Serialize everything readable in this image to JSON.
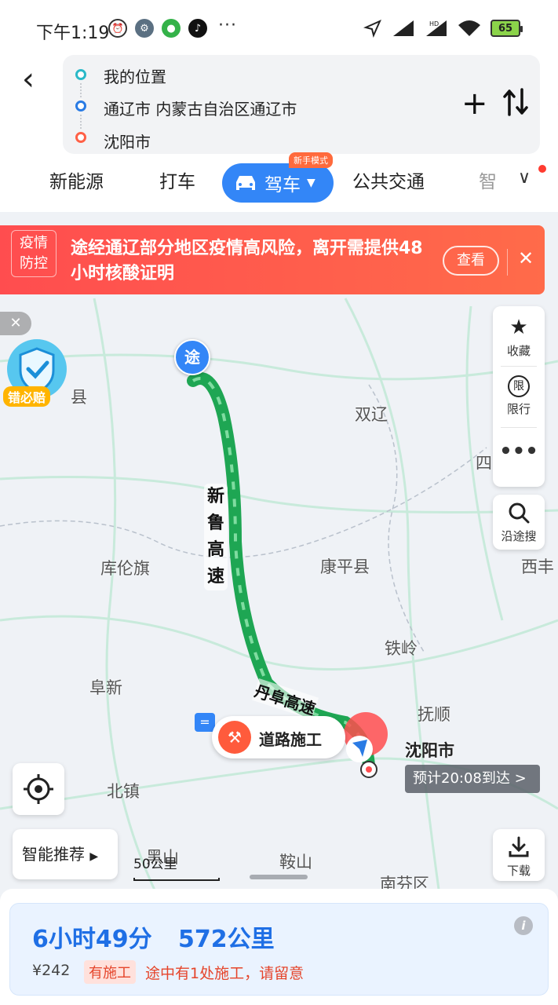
{
  "status_bar": {
    "time": "下午1:19",
    "more": "···",
    "battery": "65"
  },
  "header": {
    "route": [
      {
        "label": "我的位置",
        "color": "#2bb9c8"
      },
      {
        "label": "通辽市 内蒙古自治区通辽市",
        "color": "#2a7be4"
      },
      {
        "label": "沈阳市",
        "color": "#ff6046"
      }
    ],
    "tabs": {
      "new_energy": "新能源",
      "taxi": "打车",
      "drive": "驾车",
      "drive_badge": "新手模式",
      "transit": "公共交通",
      "more": "智"
    }
  },
  "alert": {
    "tag_line1": "疫情",
    "tag_line2": "防控",
    "message": "途经通辽部分地区疫情高风险，离开需提供48小时核酸证明",
    "view_label": "查看"
  },
  "side_panel": {
    "favorite": "收藏",
    "restriction": "限行",
    "search_along": "沿途搜",
    "download": "下载"
  },
  "map": {
    "shield_label": "错必赔",
    "waypoint": "途",
    "road_name": "新鲁高速",
    "road_name_2": "丹阜高速",
    "cities": {
      "shuangliao": "双辽",
      "si": "四",
      "kulunqi": "库伦旗",
      "kangping": "康平县",
      "xifeng": "西丰",
      "tieling": "铁岭",
      "fuxin": "阜新",
      "fushun": "抚顺",
      "shenyang": "沈阳市",
      "beizhen": "北镇",
      "heishan": "黑山",
      "anshan": "鞍山",
      "nanfen": "南芬区",
      "xian": "县"
    },
    "construction": "道路施工",
    "eta": "预计20:08到达 >",
    "scale": "50公里",
    "smart_recommend": "智能推荐"
  },
  "summary": {
    "duration": "6小时49分",
    "distance": "572公里",
    "price": "¥242",
    "warn_tag": "有施工",
    "warn_text": "途中有1处施工，请留意"
  },
  "colors": {
    "route_green": "#1ea653",
    "primary_blue": "#3386f7",
    "alert_red": "#ff4d4f"
  }
}
